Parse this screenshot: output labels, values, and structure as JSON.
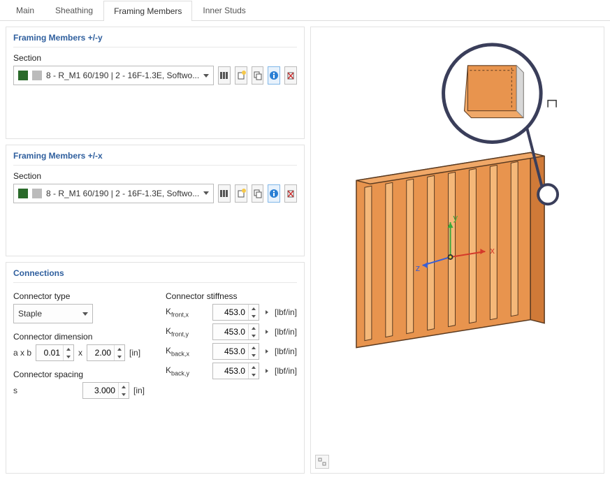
{
  "tabs": [
    "Main",
    "Sheathing",
    "Framing Members",
    "Inner Studs"
  ],
  "activeTab": 2,
  "fm_y": {
    "title": "Framing Members +/-y",
    "sectionLabel": "Section",
    "section": "8 - R_M1 60/190 | 2 - 16F-1.3E, Softwo..."
  },
  "fm_x": {
    "title": "Framing Members +/-x",
    "sectionLabel": "Section",
    "section": "8 - R_M1 60/190 | 2 - 16F-1.3E, Softwo..."
  },
  "conn": {
    "title": "Connections",
    "typeLabel": "Connector type",
    "type": "Staple",
    "dimLabel": "Connector dimension",
    "dimPrefix": "a x b",
    "a": "0.01",
    "b": "2.00",
    "dimUnit": "[in]",
    "spacingLabel": "Connector spacing",
    "sLabel": "s",
    "s": "3.000",
    "sUnit": "[in]",
    "stiffLabel": "Connector stiffness",
    "stiffUnit": "[lbf/in]",
    "k": [
      {
        "label": "K",
        "sub": "front,x",
        "val": "453.0"
      },
      {
        "label": "K",
        "sub": "front,y",
        "val": "453.0"
      },
      {
        "label": "K",
        "sub": "back,x",
        "val": "453.0"
      },
      {
        "label": "K",
        "sub": "back,y",
        "val": "453.0"
      }
    ]
  },
  "icons": {
    "library": "library-icon",
    "new": "new-icon",
    "copy": "copy-icon",
    "info": "info-icon",
    "delete": "delete-icon"
  }
}
